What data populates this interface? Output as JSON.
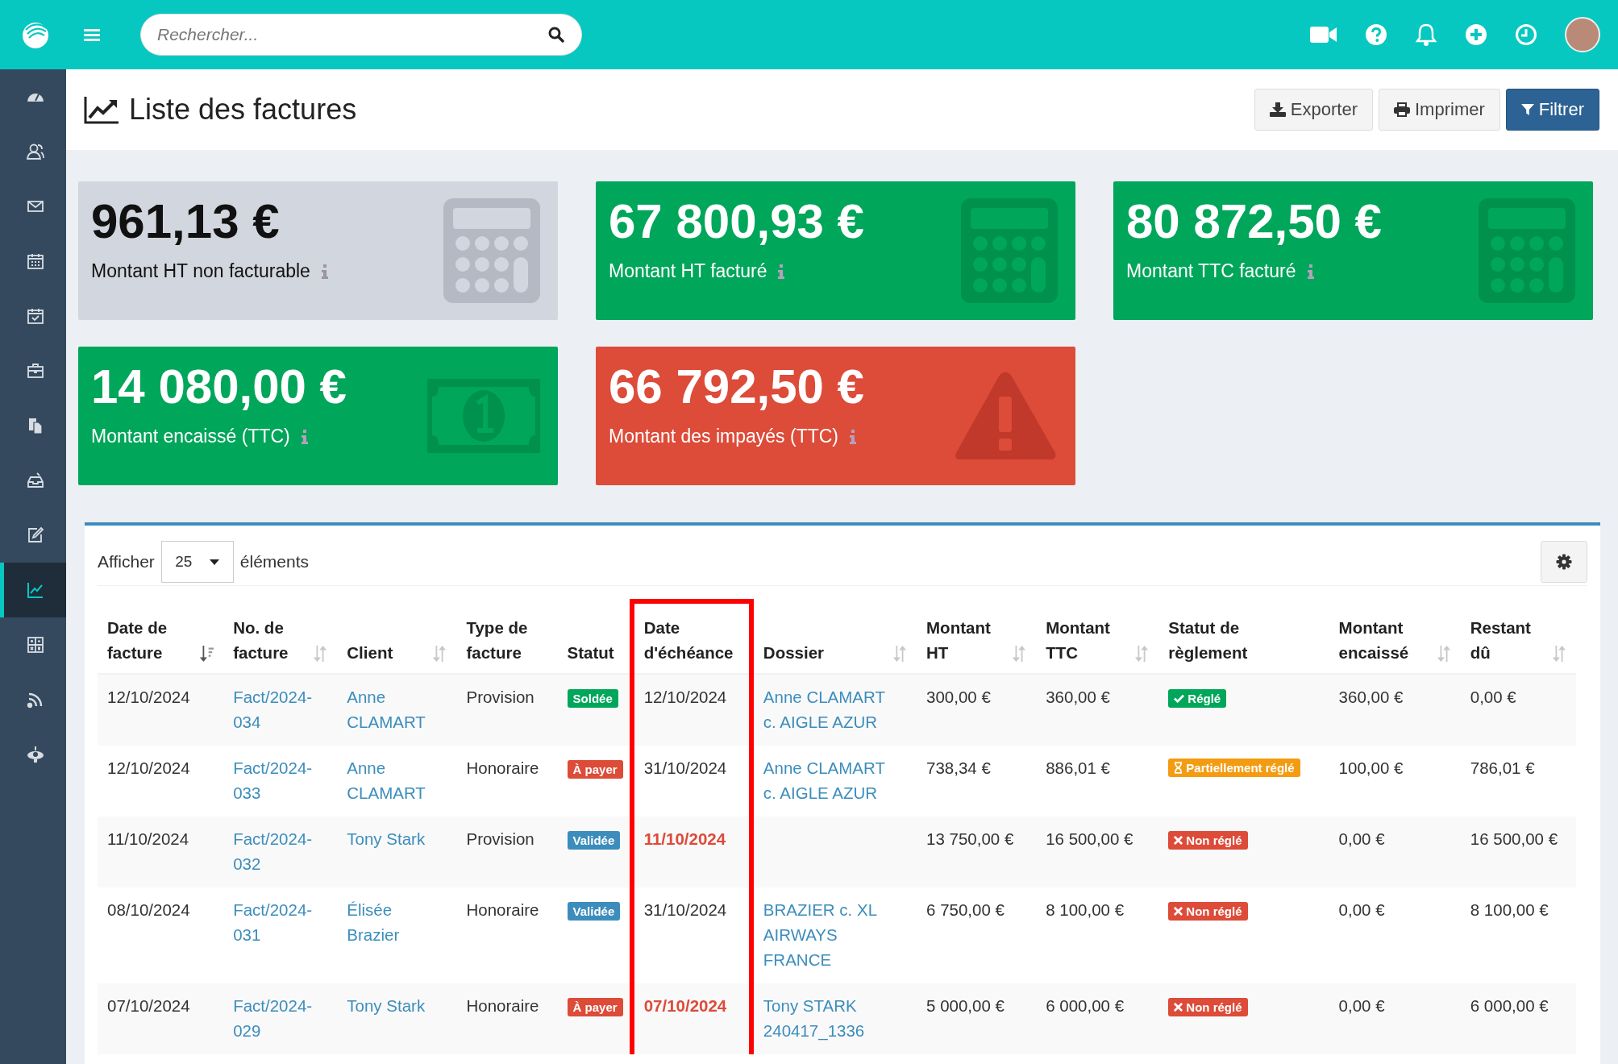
{
  "topbar": {
    "search": {
      "placeholder": "Rechercher..."
    }
  },
  "sidebar": {
    "items": [
      {
        "kind": "gauge",
        "selected": false
      },
      {
        "kind": "users",
        "selected": false
      },
      {
        "kind": "mail",
        "selected": false
      },
      {
        "kind": "calendar",
        "selected": false
      },
      {
        "kind": "calendar-check",
        "selected": false
      },
      {
        "kind": "briefcase",
        "selected": false
      },
      {
        "kind": "files",
        "selected": false
      },
      {
        "kind": "tray",
        "selected": false
      },
      {
        "kind": "edit",
        "selected": false
      },
      {
        "kind": "chart",
        "selected": true
      },
      {
        "kind": "calculator",
        "selected": false
      },
      {
        "kind": "rss",
        "selected": false
      },
      {
        "kind": "satellite",
        "selected": false
      }
    ]
  },
  "page": {
    "title": "Liste des factures",
    "buttons": [
      {
        "label": "Exporter",
        "kind": "export"
      },
      {
        "label": "Imprimer",
        "kind": "print"
      },
      {
        "label": "Filtrer",
        "kind": "filter"
      }
    ]
  },
  "stats": [
    {
      "value": "961,13 €",
      "label": "Montant HT non facturable",
      "kind": "neutral"
    },
    {
      "value": "67 800,93 €",
      "label": "Montant HT facturé",
      "kind": "success"
    },
    {
      "value": "80 872,50 €",
      "label": "Montant TTC facturé",
      "kind": "success"
    },
    {
      "value": "14 080,00 €",
      "label": "Montant encaissé (TTC)",
      "kind": "success"
    },
    {
      "value": "66 792,50 €",
      "label": "Montant des impayés (TTC)",
      "kind": "danger"
    }
  ],
  "table": {
    "length": {
      "before": "Afficher",
      "value": "25",
      "after": "éléments"
    },
    "columns": [
      {
        "label": "Date de\nfacture",
        "kind": "sorted",
        "highlighted": false
      },
      {
        "label": "No. de\nfacture",
        "kind": "sortable",
        "highlighted": false
      },
      {
        "label": "Client",
        "kind": "sortable",
        "highlighted": false
      },
      {
        "label": "Type de\nfacture",
        "kind": "plain",
        "highlighted": false
      },
      {
        "label": "Statut",
        "kind": "plain",
        "highlighted": false
      },
      {
        "label": "Date\nd'échéance",
        "kind": "plain",
        "highlighted": true
      },
      {
        "label": "Dossier",
        "kind": "sortable",
        "highlighted": false
      },
      {
        "label": "Montant\nHT",
        "kind": "sortable",
        "highlighted": false
      },
      {
        "label": "Montant\nTTC",
        "kind": "sortable",
        "highlighted": false
      },
      {
        "label": "Statut de\nrèglement",
        "kind": "plain",
        "highlighted": false
      },
      {
        "label": "Montant\nencaissé",
        "kind": "sortable",
        "highlighted": false
      },
      {
        "label": "Restant\ndû",
        "kind": "sortable",
        "highlighted": false
      }
    ],
    "rows": [
      {
        "date": "12/10/2024",
        "number": "Fact/2024-034",
        "client": "Anne CLAMART",
        "type": "Provision",
        "status": {
          "label": "Soldée",
          "kind": "settled"
        },
        "due": "12/10/2024",
        "overdue": false,
        "dossier": "Anne CLAMART c. AIGLE AZUR",
        "ht": "300,00 €",
        "ttc": "360,00 €",
        "payment": {
          "label": "Réglé",
          "kind": "paid"
        },
        "collected": "360,00 €",
        "remaining": "0,00 €"
      },
      {
        "date": "12/10/2024",
        "number": "Fact/2024-033",
        "client": "Anne CLAMART",
        "type": "Honoraire",
        "status": {
          "label": "À payer",
          "kind": "due"
        },
        "due": "31/10/2024",
        "overdue": false,
        "dossier": "Anne CLAMART c. AIGLE AZUR",
        "ht": "738,34 €",
        "ttc": "886,01 €",
        "payment": {
          "label": "Partiellement réglé",
          "kind": "partial"
        },
        "collected": "100,00 €",
        "remaining": "786,01 €"
      },
      {
        "date": "11/10/2024",
        "number": "Fact/2024-032",
        "client": "Tony Stark",
        "type": "Provision",
        "status": {
          "label": "Validée",
          "kind": "validated"
        },
        "due": "11/10/2024",
        "overdue": true,
        "ht": "13 750,00 €",
        "ttc": "16 500,00 €",
        "payment": {
          "label": "Non réglé",
          "kind": "unpaid"
        },
        "collected": "0,00 €",
        "remaining": "16 500,00 €"
      },
      {
        "date": "08/10/2024",
        "number": "Fact/2024-031",
        "client": "Élisée Brazier",
        "type": "Honoraire",
        "status": {
          "label": "Validée",
          "kind": "validated"
        },
        "due": "31/10/2024",
        "overdue": false,
        "dossier": "BRAZIER c. XL AIRWAYS FRANCE",
        "ht": "6 750,00 €",
        "ttc": "8 100,00 €",
        "payment": {
          "label": "Non réglé",
          "kind": "unpaid"
        },
        "collected": "0,00 €",
        "remaining": "8 100,00 €"
      },
      {
        "date": "07/10/2024",
        "number": "Fact/2024-029",
        "client": "Tony Stark",
        "type": "Honoraire",
        "status": {
          "label": "À payer",
          "kind": "due"
        },
        "due": "07/10/2024",
        "overdue": true,
        "dossier": "Tony STARK 240417_1336",
        "ht": "5 000,00 €",
        "ttc": "6 000,00 €",
        "payment": {
          "label": "Non réglé",
          "kind": "unpaid"
        },
        "collected": "0,00 €",
        "remaining": "6 000,00 €"
      }
    ]
  }
}
